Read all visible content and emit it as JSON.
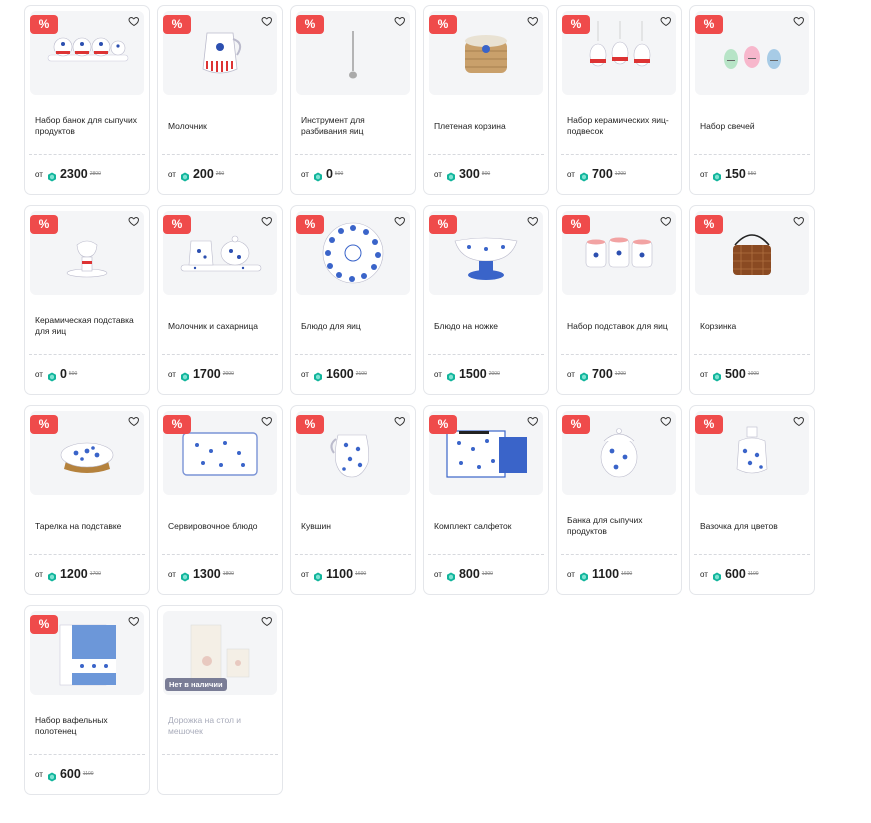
{
  "labels": {
    "discount": "%",
    "price_prefix": "от",
    "out_of_stock": "Нет в наличии"
  },
  "colors": {
    "discount_badge": "#ef4b4b",
    "coin": "#11b59c",
    "stock_badge": "#7a7d96",
    "muted_text": "#a9acbb"
  },
  "icons": {
    "favorite": "heart-icon",
    "currency": "coin-icon"
  },
  "products": [
    {
      "name": "Набор банок для сыпучих продуктов",
      "price": "2300",
      "old_price": "2800",
      "image": "jars-set"
    },
    {
      "name": "Молочник",
      "price": "200",
      "old_price": "250",
      "image": "milk-jug"
    },
    {
      "name": "Инструмент для разбивания яиц",
      "price": "0",
      "old_price": "500",
      "image": "egg-tool"
    },
    {
      "name": "Плетеная корзина",
      "price": "300",
      "old_price": "800",
      "image": "woven-basket"
    },
    {
      "name": "Набор керамических яиц-подвесок",
      "price": "700",
      "old_price": "1200",
      "image": "hanging-eggs"
    },
    {
      "name": "Набор свечей",
      "price": "150",
      "old_price": "550",
      "image": "candles"
    },
    {
      "name": "Керамическая подставка для яиц",
      "price": "0",
      "old_price": "500",
      "image": "egg-cup"
    },
    {
      "name": "Молочник и сахарница",
      "price": "1700",
      "old_price": "2000",
      "image": "milk-sugar"
    },
    {
      "name": "Блюдо для яиц",
      "price": "1600",
      "old_price": "2100",
      "image": "egg-plate"
    },
    {
      "name": "Блюдо на ножке",
      "price": "1500",
      "old_price": "2000",
      "image": "stand-bowl"
    },
    {
      "name": "Набор подставок для яиц",
      "price": "700",
      "old_price": "1200",
      "image": "egg-cups-set"
    },
    {
      "name": "Корзинка",
      "price": "500",
      "old_price": "1000",
      "image": "basket"
    },
    {
      "name": "Тарелка на подставке",
      "price": "1200",
      "old_price": "1700",
      "image": "plate-stand"
    },
    {
      "name": "Сервировочное блюдо",
      "price": "1300",
      "old_price": "1800",
      "image": "serving-tray"
    },
    {
      "name": "Кувшин",
      "price": "1100",
      "old_price": "1600",
      "image": "pitcher"
    },
    {
      "name": "Комплект салфеток",
      "price": "800",
      "old_price": "1300",
      "image": "napkins"
    },
    {
      "name": "Банка для сыпучих продуктов",
      "price": "1100",
      "old_price": "1600",
      "image": "egg-jar"
    },
    {
      "name": "Вазочка для цветов",
      "price": "600",
      "old_price": "1100",
      "image": "vase"
    },
    {
      "name": "Набор вафельных полотенец",
      "price": "600",
      "old_price": "1100",
      "image": "towels"
    },
    {
      "name": "Дорожка на стол и мешочек",
      "price": "",
      "old_price": "",
      "image": "table-runner",
      "out_of_stock": true
    }
  ]
}
